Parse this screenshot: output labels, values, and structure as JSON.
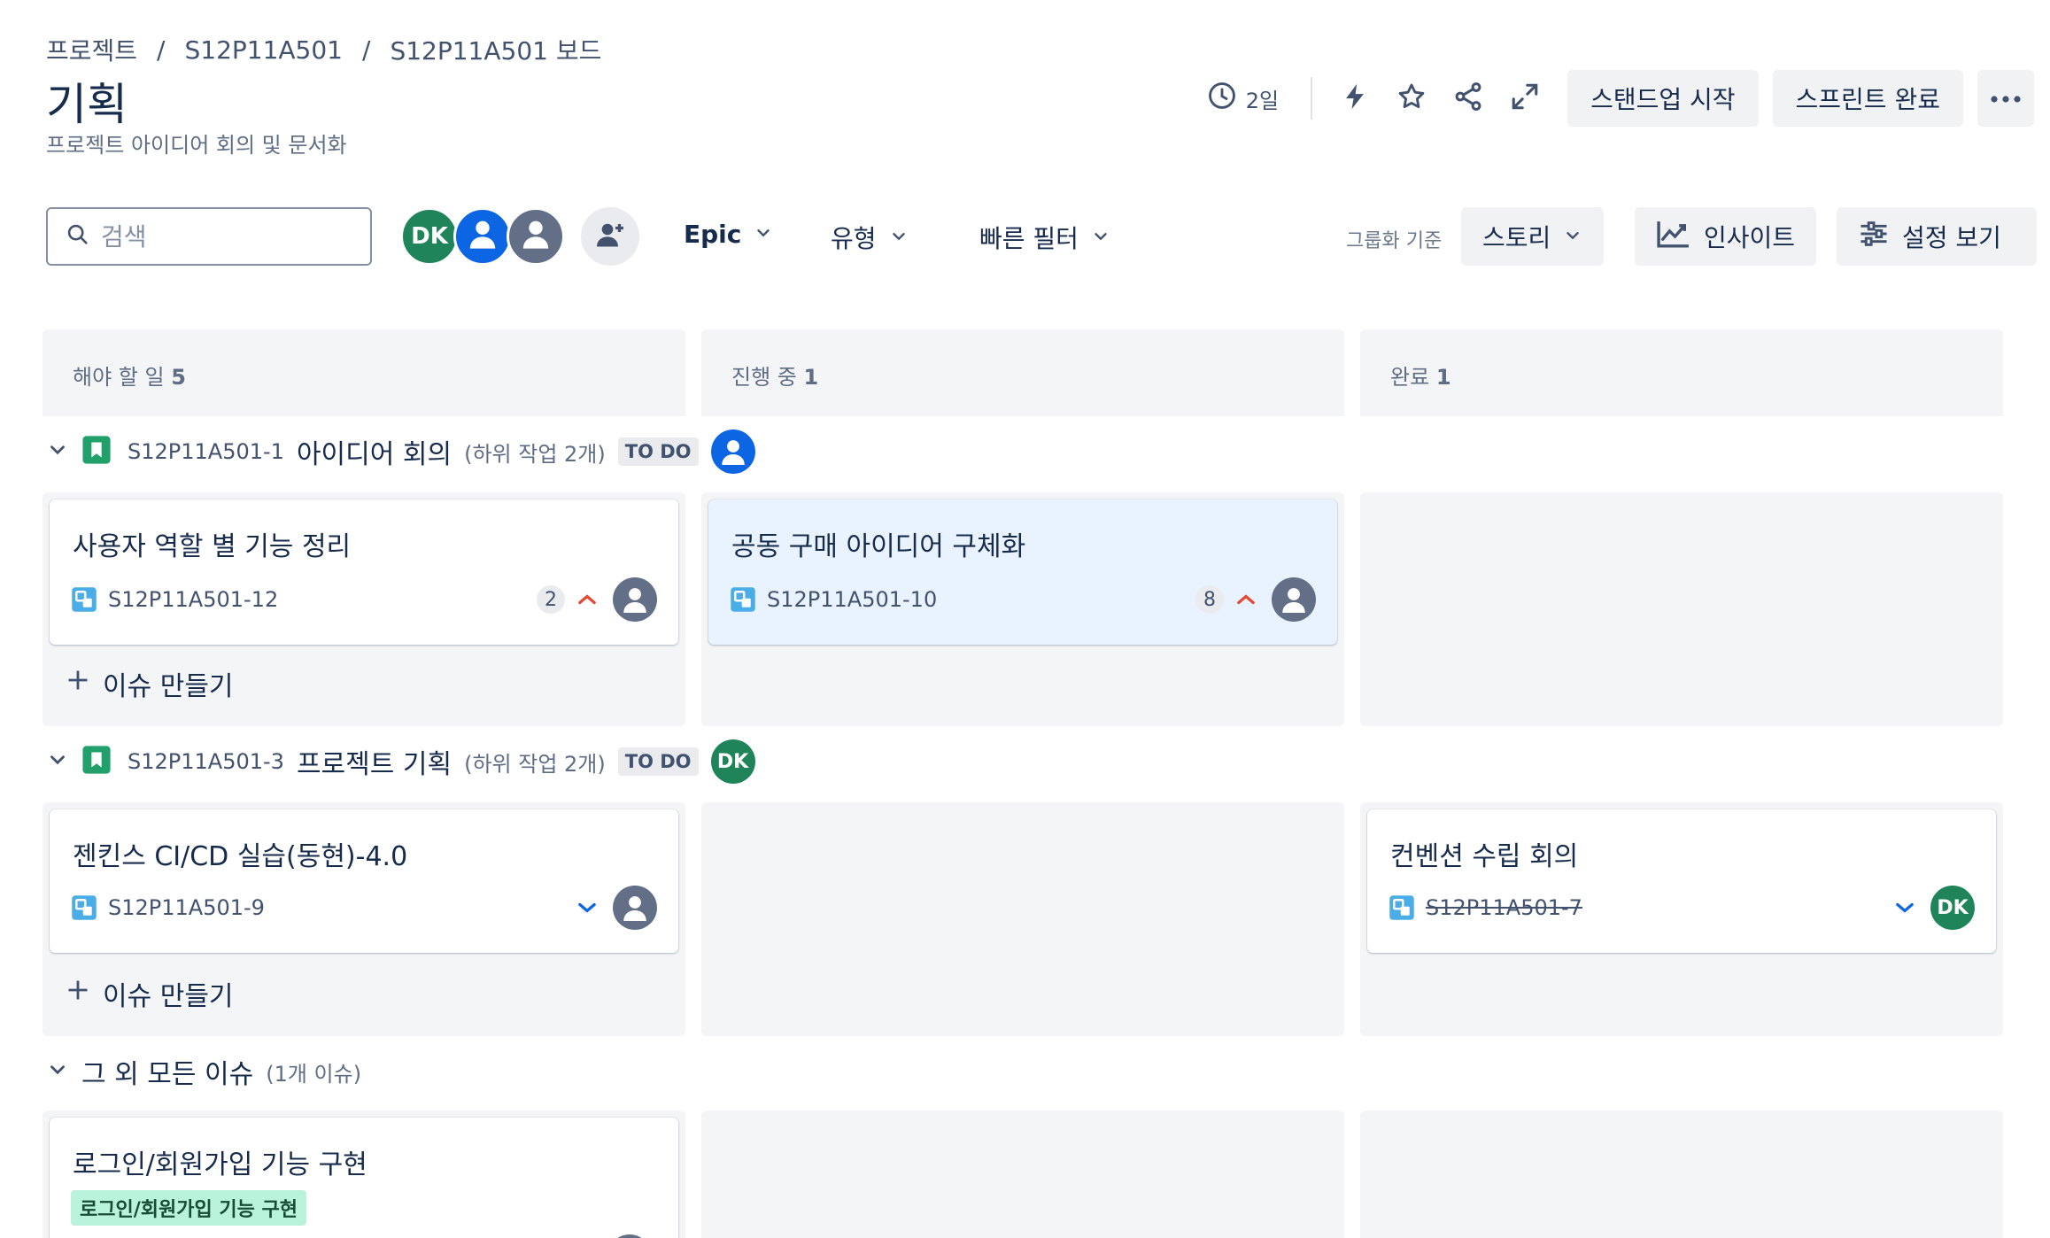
{
  "breadcrumb": [
    "프로젝트",
    "S12P11A501",
    "S12P11A501 보드"
  ],
  "page": {
    "title": "기획",
    "subtitle": "프로젝트 아이디어 회의 및 문서화"
  },
  "header_actions": {
    "time_remaining": "2일",
    "standup_label": "스탠드업 시작",
    "complete_sprint_label": "스프린트 완료"
  },
  "toolbar": {
    "search_placeholder": "검색",
    "avatars": [
      {
        "initials": "DK",
        "color": "#1f845a"
      },
      {
        "initials": "",
        "color": "#0c66e4"
      },
      {
        "initials": "",
        "color": "#626f86"
      }
    ],
    "filters": {
      "epic": "Epic",
      "type": "유형",
      "quick": "빠른 필터"
    },
    "group_by_label": "그룹화 기준",
    "group_by_value": "스토리",
    "insights_label": "인사이트",
    "view_settings_label": "설정 보기"
  },
  "columns": [
    {
      "name": "해야 할 일",
      "count": "5"
    },
    {
      "name": "진행 중",
      "count": "1"
    },
    {
      "name": "완료",
      "count": "1"
    }
  ],
  "stories": [
    {
      "key": "S12P11A501-1",
      "title": "아이디어 회의",
      "subtasks": "(하위 작업 2개)",
      "status": "TO DO",
      "assignee": "",
      "cards": {
        "todo": {
          "title": "사용자 역할 별 기능 정리",
          "key": "S12P11A501-12",
          "points": "2",
          "priority": "high"
        },
        "in_progress": {
          "title": "공동 구매 아이디어 구체화",
          "key": "S12P11A501-10",
          "points": "8",
          "priority": "high"
        }
      }
    },
    {
      "key": "S12P11A501-3",
      "title": "프로젝트 기획",
      "subtasks": "(하위 작업 2개)",
      "status": "TO DO",
      "assignee": "DK",
      "cards": {
        "todo": {
          "title": "젠킨스 CI/CD 실습(동현)-4.0",
          "key": "S12P11A501-9",
          "priority": "low"
        },
        "done": {
          "title": "컨벤션 수립 회의",
          "key": "S12P11A501-7",
          "priority": "low",
          "assignee": "DK"
        }
      }
    }
  ],
  "create_issue_label": "이슈 만들기",
  "other_issues": {
    "title": "그 외 모든 이슈",
    "count": "(1개 이슈)",
    "card": {
      "title": "로그인/회원가입 기능 구현",
      "label": "로그인/회원가입 기능 구현"
    }
  },
  "colors": {
    "done_green": "#1f845a",
    "priority_high": "#e34935",
    "priority_low": "#0c66e4",
    "story_green": "#22a06b"
  }
}
